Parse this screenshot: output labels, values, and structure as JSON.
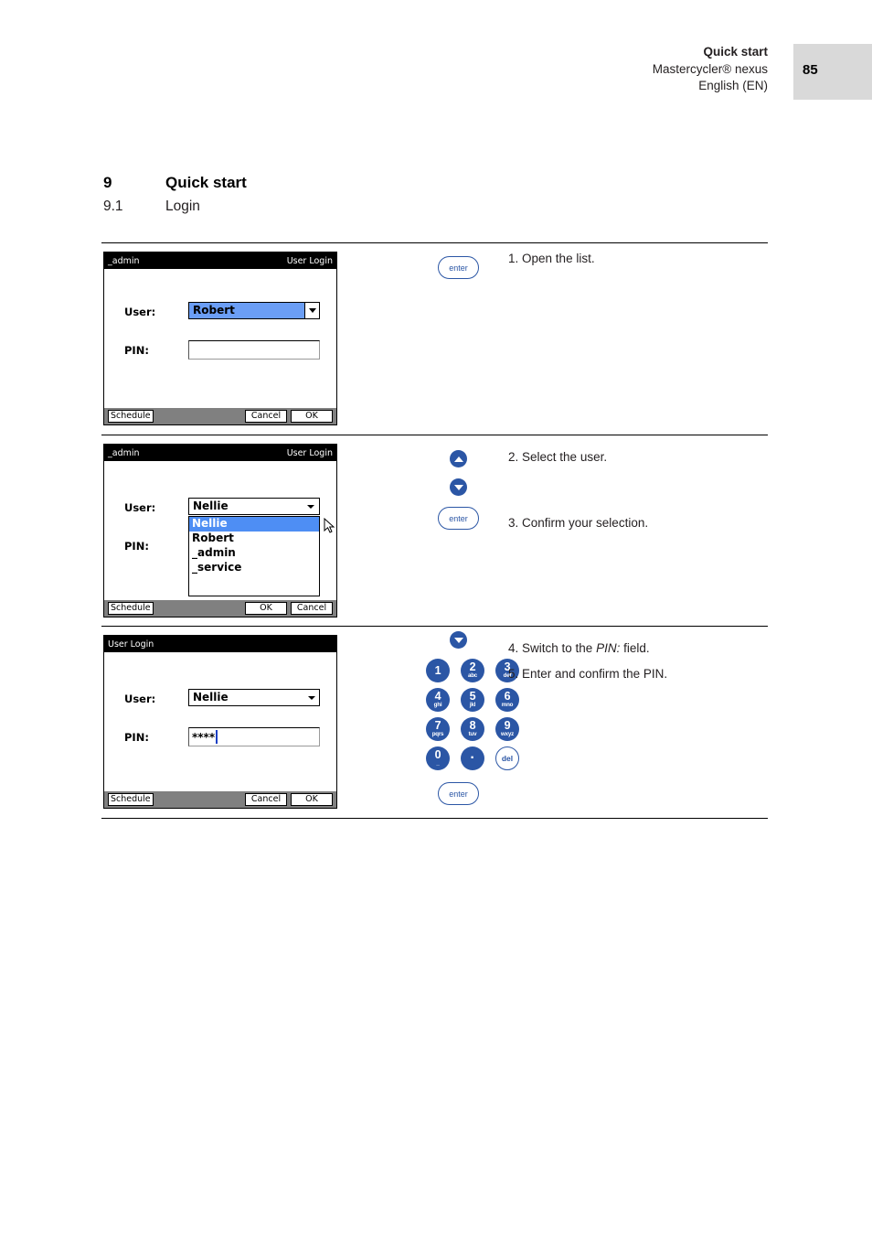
{
  "header": {
    "title": "Quick start",
    "product": "Mastercycler® nexus",
    "language": "English (EN)",
    "page_number": "85"
  },
  "headings": {
    "chapter_number": "9",
    "chapter_title": "Quick start",
    "section_number": "9.1",
    "section_title": "Login"
  },
  "colors": {
    "key_blue": "#2b56a5",
    "selection_blue": "#6b9ef5",
    "list_highlight_blue": "#4e8ef4",
    "page_box_gray": "#d9d9d9",
    "device_footer_gray": "#808080"
  },
  "steps": [
    {
      "screen": {
        "titlebar_left": "_admin",
        "titlebar_right": "User Login",
        "user_label": "User:",
        "user_value": "Robert",
        "user_selected": true,
        "pin_label": "PIN:",
        "pin_value": "",
        "dropdown_open": false,
        "footer_left_button": "Schedule",
        "footer_right_buttons": [
          "Cancel",
          "OK"
        ]
      },
      "keys": [
        {
          "type": "enter",
          "label": "enter"
        }
      ],
      "instructions": [
        {
          "number": "1.",
          "text": "Open the list."
        }
      ]
    },
    {
      "screen": {
        "titlebar_left": "_admin",
        "titlebar_right": "User Login",
        "user_label": "User:",
        "user_value": "Nellie",
        "user_selected": false,
        "pin_label": "PIN:",
        "pin_value": "",
        "dropdown_open": true,
        "dropdown_items": [
          "Nellie",
          "Robert",
          "_admin",
          "_service"
        ],
        "dropdown_selected_index": 0,
        "footer_left_button": "Schedule",
        "footer_right_buttons": [
          "OK",
          "Cancel"
        ]
      },
      "keys": [
        {
          "type": "arrow-up",
          "label": "up-arrow"
        },
        {
          "type": "arrow-down",
          "label": "down-arrow"
        },
        {
          "type": "enter",
          "label": "enter"
        }
      ],
      "instructions": [
        {
          "number": "2.",
          "text": "Select the user."
        },
        {
          "number": "3.",
          "text": "Confirm your selection."
        }
      ]
    },
    {
      "screen": {
        "titlebar_left": "User Login",
        "titlebar_right": "",
        "user_label": "User:",
        "user_value": "Nellie",
        "user_selected": false,
        "pin_label": "PIN:",
        "pin_value": "****",
        "dropdown_open": false,
        "footer_left_button": "Schedule",
        "footer_right_buttons": [
          "Cancel",
          "OK"
        ]
      },
      "keys": [
        {
          "type": "arrow-down",
          "label": "down-arrow"
        },
        {
          "type": "keypad",
          "label": "numeric-keypad"
        },
        {
          "type": "enter",
          "label": "enter"
        }
      ],
      "instructions": [
        {
          "number": "4.",
          "text": "Switch to the ",
          "italic": "PIN:",
          "text_after": " field."
        },
        {
          "number": "5.",
          "text": "Enter and confirm the PIN."
        }
      ]
    }
  ],
  "keypad": {
    "keys": [
      {
        "main": "1",
        "sub": ""
      },
      {
        "main": "2",
        "sub": "abc"
      },
      {
        "main": "3",
        "sub": "def"
      },
      {
        "main": "4",
        "sub": "ghi"
      },
      {
        "main": "5",
        "sub": "jkl"
      },
      {
        "main": "6",
        "sub": "mno"
      },
      {
        "main": "7",
        "sub": "pqrs"
      },
      {
        "main": "8",
        "sub": "tuv"
      },
      {
        "main": "9",
        "sub": "wxyz"
      },
      {
        "main": "0",
        "sub": "_"
      },
      {
        "main": "·",
        "sub": ""
      },
      {
        "main": "del",
        "sub": "",
        "outline": true
      }
    ]
  }
}
